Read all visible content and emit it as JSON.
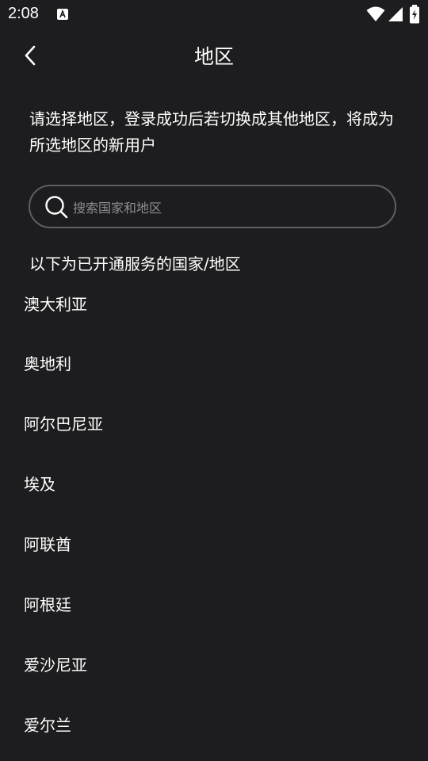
{
  "status_bar": {
    "time": "2:08",
    "app_icon": "a-notification-icon",
    "icons": [
      "wifi-icon",
      "signal-icon",
      "battery-charging-icon"
    ]
  },
  "header": {
    "back_icon": "chevron-left-icon",
    "title": "地区"
  },
  "intro": {
    "text": "请选择地区，登录成功后若切换成其他地区，将成为所选地区的新用户"
  },
  "search": {
    "placeholder": "搜索国家和地区",
    "value": "",
    "icon": "search-icon"
  },
  "list_header": "以下为已开通服务的国家/地区",
  "regions": [
    {
      "label": "澳大利亚"
    },
    {
      "label": "奥地利"
    },
    {
      "label": "阿尔巴尼亚"
    },
    {
      "label": "埃及"
    },
    {
      "label": "阿联酋"
    },
    {
      "label": "阿根廷"
    },
    {
      "label": "爱沙尼亚"
    },
    {
      "label": "爱尔兰"
    }
  ],
  "colors": {
    "background": "#1d1d1f",
    "text": "#ffffff",
    "placeholder": "#8d8d92",
    "search_border": "#5f5f63"
  }
}
